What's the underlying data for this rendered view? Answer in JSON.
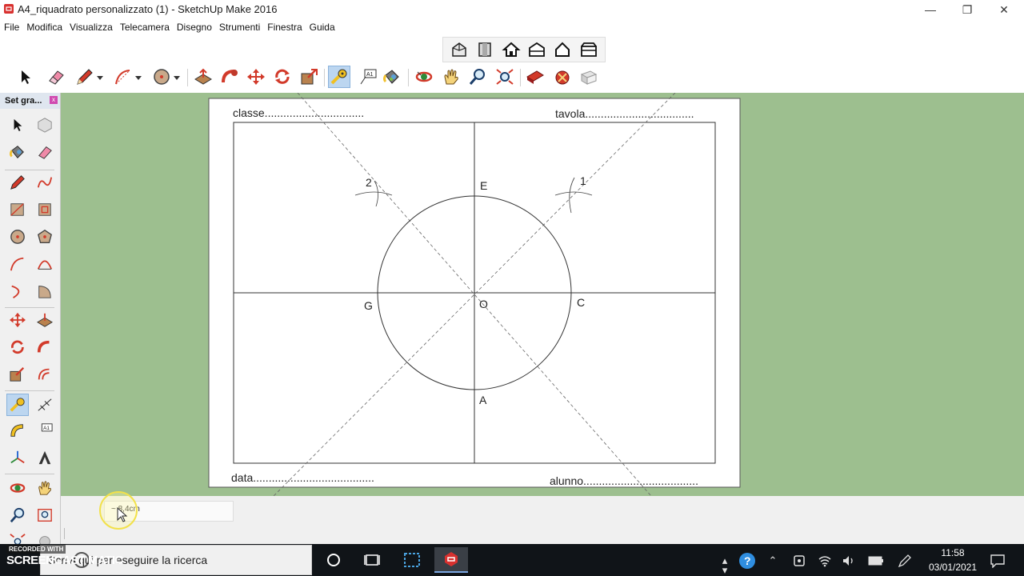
{
  "window": {
    "title": "A4_riquadrato personalizzato (1) - SketchUp Make 2016",
    "controls": {
      "minimize": "—",
      "restore": "❐",
      "close": "✕"
    }
  },
  "menubar": {
    "items": [
      "File",
      "Modifica",
      "Visualizza",
      "Telecamera",
      "Disegno",
      "Strumenti",
      "Finestra",
      "Guida"
    ]
  },
  "toolbar_views": {
    "icons": [
      "iso-view-icon",
      "front-view-icon",
      "home-view-icon",
      "back-view-icon",
      "right-view-icon",
      "left-view-icon"
    ]
  },
  "toolbar_main": {
    "icons": [
      "select-icon",
      "eraser-icon",
      "pencil-icon",
      "arc-icon",
      "circle-icon",
      "push-pull-icon",
      "follow-me-icon",
      "move-icon",
      "rotate-icon",
      "scale-icon",
      "tape-measure-icon",
      "text-icon",
      "paint-bucket-icon",
      "orbit-icon",
      "pan-icon",
      "zoom-icon",
      "zoom-extents-icon",
      "warehouse-icon",
      "extension-icon",
      "layout-icon"
    ],
    "active": "tape-measure-icon"
  },
  "toolset": {
    "title": "Set gra...",
    "close_label": "x"
  },
  "drawing": {
    "header_left": "classe................................",
    "header_right": "tavola...................................",
    "footer_left": "data.......................................",
    "footer_right": "alunno.....................................",
    "point_labels": {
      "E": "E",
      "C": "C",
      "G": "G",
      "O": "O",
      "A": "A",
      "mark_1": "1",
      "mark_2": "2"
    }
  },
  "measurement": {
    "value": "~ 8,4cm"
  },
  "taskbar": {
    "search_placeholder": "Scrivi qui per eseguire la ricerca",
    "watermark_top": "RECORDED WITH",
    "watermark_brand": "SCREENCAST MATIC",
    "time": "11:58",
    "date": "03/01/2021"
  },
  "colors": {
    "viewport_bg": "#9dbf8f",
    "taskbar_bg": "#101418",
    "active_tool_bg": "#bcd6f0"
  }
}
